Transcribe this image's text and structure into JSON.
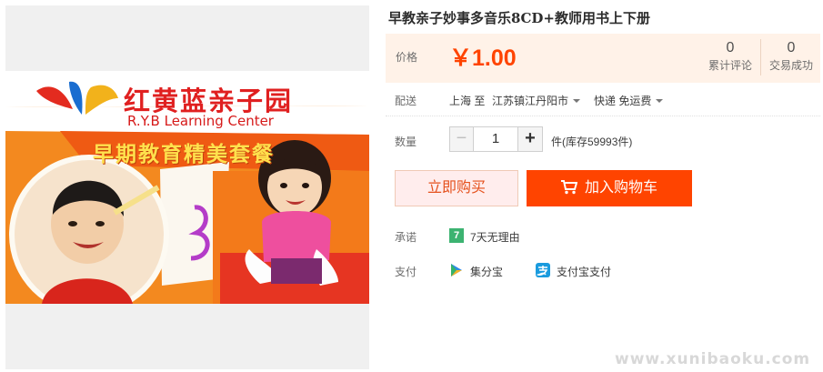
{
  "product": {
    "title": "早教亲子妙事多音乐8CD+教师用书上下册",
    "image": {
      "brand_cn": "红黄蓝亲子园",
      "brand_en": "R.Y.B Learning Center",
      "slogan": "早期教育精美套餐"
    }
  },
  "price": {
    "label": "价格",
    "value": "￥1.00",
    "color": "#ff4400",
    "reviews_count": "0",
    "reviews_label": "累计评论",
    "trades_count": "0",
    "trades_label": "交易成功"
  },
  "shipping": {
    "label": "配送",
    "from": "上海 至",
    "to": "江苏镇江丹阳市",
    "method": "快递 免运费"
  },
  "quantity": {
    "label": "数量",
    "minus": "−",
    "value": "1",
    "plus": "+",
    "stock": "件(库存59993件)"
  },
  "actions": {
    "buy_now": "立即购买",
    "add_to_cart": "加入购物车",
    "cart_icon": "cart-icon"
  },
  "promise": {
    "label": "承诺",
    "badge": "7",
    "text": "7天无理由"
  },
  "payment": {
    "label": "支付",
    "methods": [
      {
        "icon": "jifenbao-icon",
        "text": "集分宝"
      },
      {
        "icon": "alipay-icon",
        "text": "支付宝支付"
      }
    ]
  },
  "watermark": "www.xunibaoku.com"
}
